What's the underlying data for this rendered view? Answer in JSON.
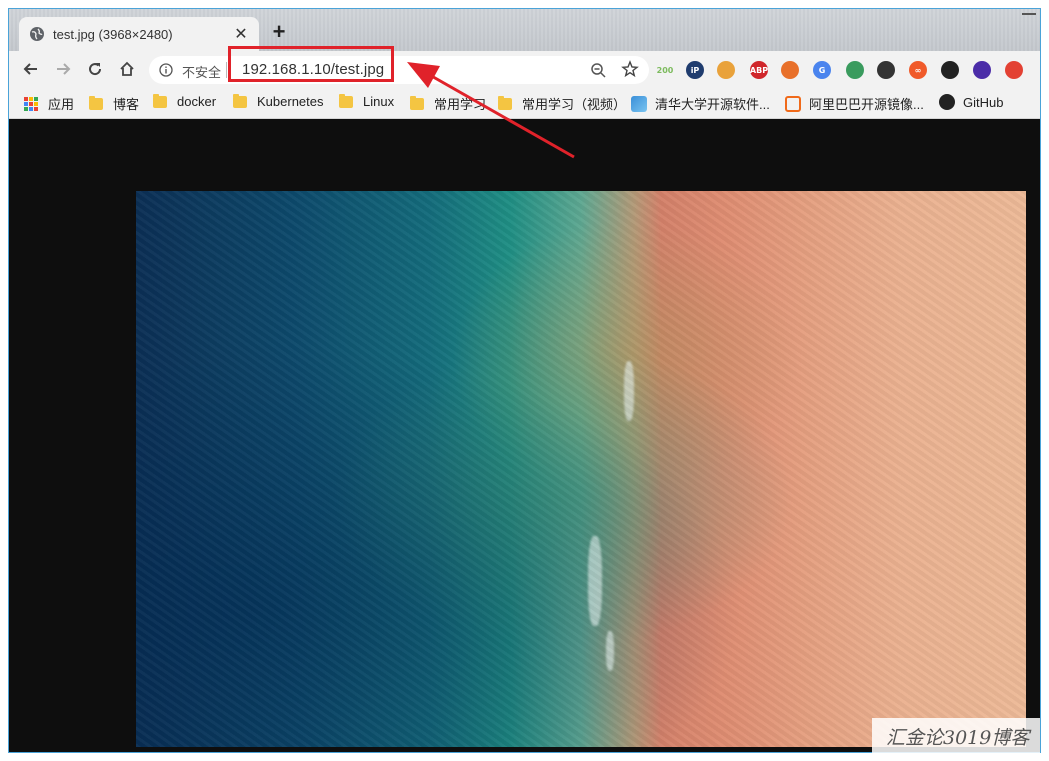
{
  "tab": {
    "title": "test.jpg (3968×2480)",
    "close_glyph": "✕",
    "new_tab_glyph": "+"
  },
  "toolbar": {
    "security_label": "不安全",
    "url": "192.168.1.10/test.jpg",
    "icons": [
      "back-icon",
      "forward-icon",
      "reload-icon",
      "home-icon",
      "info-icon",
      "zoom-out-icon",
      "star-icon"
    ]
  },
  "extensions": [
    {
      "name": "extension-200",
      "label": "200",
      "color": "#7dbb5e"
    },
    {
      "name": "extension-ip",
      "label": "iP",
      "color": "#1f3c6e"
    },
    {
      "name": "extension-ring",
      "label": "",
      "color": "#e9a23b"
    },
    {
      "name": "extension-abp",
      "label": "ABP",
      "color": "#d0262b"
    },
    {
      "name": "extension-fox",
      "label": "",
      "color": "#e8702a"
    },
    {
      "name": "extension-translate",
      "label": "G",
      "color": "#4a84ee"
    },
    {
      "name": "extension-brush",
      "label": "",
      "color": "#3a9b5e"
    },
    {
      "name": "extension-sync",
      "label": "",
      "color": "#333333"
    },
    {
      "name": "extension-infinity",
      "label": "∞",
      "color": "#f05a2a"
    },
    {
      "name": "extension-tampermonkey",
      "label": "",
      "color": "#222222"
    },
    {
      "name": "extension-diamond",
      "label": "",
      "color": "#4b2ca8"
    },
    {
      "name": "extension-chrome",
      "label": "",
      "color": "#e34133"
    }
  ],
  "bookmarks": [
    {
      "label": "应用",
      "type": "apps"
    },
    {
      "label": "博客",
      "type": "folder"
    },
    {
      "label": "docker",
      "type": "folder"
    },
    {
      "label": "Kubernetes",
      "type": "folder"
    },
    {
      "label": "Linux",
      "type": "folder"
    },
    {
      "label": "常用学习",
      "type": "folder"
    },
    {
      "label": "常用学习（视频）",
      "type": "folder"
    },
    {
      "label": "清华大学开源软件...",
      "type": "site"
    },
    {
      "label": "阿里巴巴开源镜像...",
      "type": "site"
    },
    {
      "label": "GitHub",
      "type": "site"
    }
  ],
  "colors": {
    "highlight": "#e0222a",
    "arrow": "#e0222a",
    "background": "#0e0e0e"
  },
  "watermark": "汇金论3019博客"
}
